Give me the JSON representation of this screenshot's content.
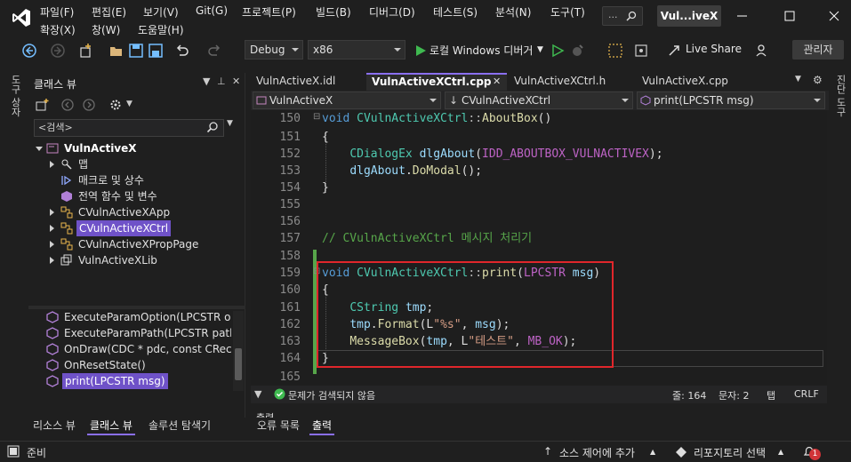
{
  "menu": {
    "items": [
      "파일(F)",
      "편집(E)",
      "보기(V)",
      "Git(G)",
      "프로젝트(P)",
      "빌드(B)",
      "디버그(D)",
      "테스트(S)",
      "분석(N)",
      "도구(T)"
    ],
    "items2": [
      "확장(X)",
      "창(W)",
      "도움말(H)"
    ],
    "search_text": "...",
    "solution_title": "Vul...iveX"
  },
  "toolbar": {
    "config": "Debug",
    "platform": "x86",
    "run_label": "로컬 Windows 디버거",
    "live_share": "Live Share",
    "admin": "관리자"
  },
  "left_strip": {
    "label": "도구 상자"
  },
  "right_strip": {
    "label": "진단 도구"
  },
  "class_view": {
    "title": "클래스 뷰",
    "search_placeholder": "<검색>",
    "tree": [
      {
        "label": "VulnActiveX",
        "icon": "project-icon"
      },
      {
        "label": "맵",
        "icon": "map-icon"
      },
      {
        "label": "매크로 및 상수",
        "icon": "macro-icon"
      },
      {
        "label": "전역 함수 및 변수",
        "icon": "globals-icon"
      },
      {
        "label": "CVulnActiveXApp",
        "icon": "class-icon"
      },
      {
        "label": "CVulnActiveXCtrl",
        "icon": "class-icon"
      },
      {
        "label": "CVulnActiveXPropPage",
        "icon": "class-icon"
      },
      {
        "label": "VulnActiveXLib",
        "icon": "library-icon"
      }
    ],
    "members": [
      "ExecuteParamOption(LPCSTR op)",
      "ExecuteParamPath(LPCSTR path)",
      "OnDraw(CDC * pdc, const CRect &",
      "OnResetState()",
      "print(LPCSTR msg)"
    ]
  },
  "bottom_tabs": [
    "리소스 뷰",
    "클래스 뷰",
    "솔루션 탐색기"
  ],
  "editor_tabs": [
    "VulnActiveX.idl",
    "VulnActiveXCtrl.cpp",
    "VulnActiveXCtrl.h",
    "VulnActiveX.cpp"
  ],
  "nav": {
    "project": "VulnActiveX",
    "scope": "CVulnActiveXCtrl",
    "member": "print(LPCSTR msg)"
  },
  "code": {
    "line_numbers": [
      "150",
      "151",
      "152",
      "153",
      "154",
      "155",
      "156",
      "157",
      "158",
      "159",
      "160",
      "161",
      "162",
      "163",
      "164",
      "165"
    ],
    "l150_kw": "void",
    "l150_cls": "CVulnActiveXCtrl",
    "l150_sep": "::",
    "l150_fn": "AboutBox",
    "l150_end": "()",
    "l151": "{",
    "l152_cls": "CDialogEx",
    "l152_var": "dlgAbout",
    "l152_open": "(",
    "l152_mac": "IDD_ABOUTBOX_VULNACTIVEX",
    "l152_end": ");",
    "l153_var": "dlgAbout",
    "l153_dot": ".",
    "l153_fn": "DoModal",
    "l153_end": "();",
    "l154": "}",
    "l157": "// CVulnActiveXCtrl 메시지 처리기",
    "l159_kw": "void",
    "l159_cls": "CVulnActiveXCtrl",
    "l159_sep": "::",
    "l159_fn": "print",
    "l159_open": "(",
    "l159_mac": "LPCSTR",
    "l159_var": "msg",
    "l159_end": ")",
    "l160": "{",
    "l161_cls": "CString",
    "l161_var": "tmp",
    "l161_end": ";",
    "l162_var": "tmp",
    "l162_dot": ".",
    "l162_fn": "Format",
    "l162_open": "(L",
    "l162_str": "\"%s\"",
    "l162_comma": ",",
    "l162_var2": "msg",
    "l162_end": ");",
    "l163_fn": "MessageBox",
    "l163_open": "(",
    "l163_var": "tmp",
    "l163_comma": ", L",
    "l163_str": "\"테스트\"",
    "l163_comma2": ",",
    "l163_mac": "MB_OK",
    "l163_end": ");",
    "l164": "}"
  },
  "editor_status": {
    "issues": "문제가 검색되지 않음",
    "line": "줄: 164",
    "col": "문자: 2",
    "tab": "탭",
    "eol": "CRLF"
  },
  "output": {
    "header": "출력",
    "tabs": [
      "오류 목록",
      "출력"
    ]
  },
  "status": {
    "ready": "준비",
    "source_control": "소스 제어에 추가",
    "repo": "리포지토리 선택",
    "notifications": "1"
  }
}
